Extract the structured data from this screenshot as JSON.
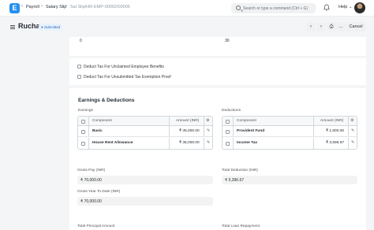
{
  "navbar": {
    "logo_letter": "E",
    "breadcrumbs": [
      "Payroll",
      "Salary Slip",
      "Sal Slip/HR-EMP-00002/00005"
    ],
    "search_placeholder": "Search or type a command (Ctrl + G)",
    "help_label": "Help"
  },
  "page": {
    "title": "Rucha",
    "status": "Submitted",
    "cancel_label": "Cancel"
  },
  "top_values": {
    "left": "0",
    "right": "30"
  },
  "checkboxes": [
    "Deduct Tax For Unclaimed Employee Benefits",
    "Deduct Tax For Unsubmitted Tax Exemption Proof"
  ],
  "section": {
    "title": "Earnings & Deductions"
  },
  "earnings": {
    "label": "Earnings",
    "col_component": "Component",
    "col_amount": "Amount (INR)",
    "rows": [
      {
        "component": "Basic",
        "amount": "₹ 35,000.00"
      },
      {
        "component": "House Rent Allowance",
        "amount": "₹ 35,000.00"
      }
    ]
  },
  "deductions": {
    "label": "Deductions",
    "col_component": "Component",
    "col_amount": "Amount (INR)",
    "rows": [
      {
        "component": "Provident Fund",
        "amount": "₹ 1,800.00"
      },
      {
        "component": "Income Tax",
        "amount": "₹ 3,596.67"
      }
    ]
  },
  "totals": {
    "gross_pay_label": "Gross Pay (INR)",
    "gross_pay_value": "₹ 70,000.00",
    "total_deduction_label": "Total Deduction (INR)",
    "total_deduction_value": "₹ 5,396.67",
    "gross_ytd_label": "Gross Year To Date (INR)",
    "gross_ytd_value": "₹ 70,000.00",
    "total_principal_label": "Total Principal Amount",
    "total_loan_label": "Total Loan Repayment"
  }
}
